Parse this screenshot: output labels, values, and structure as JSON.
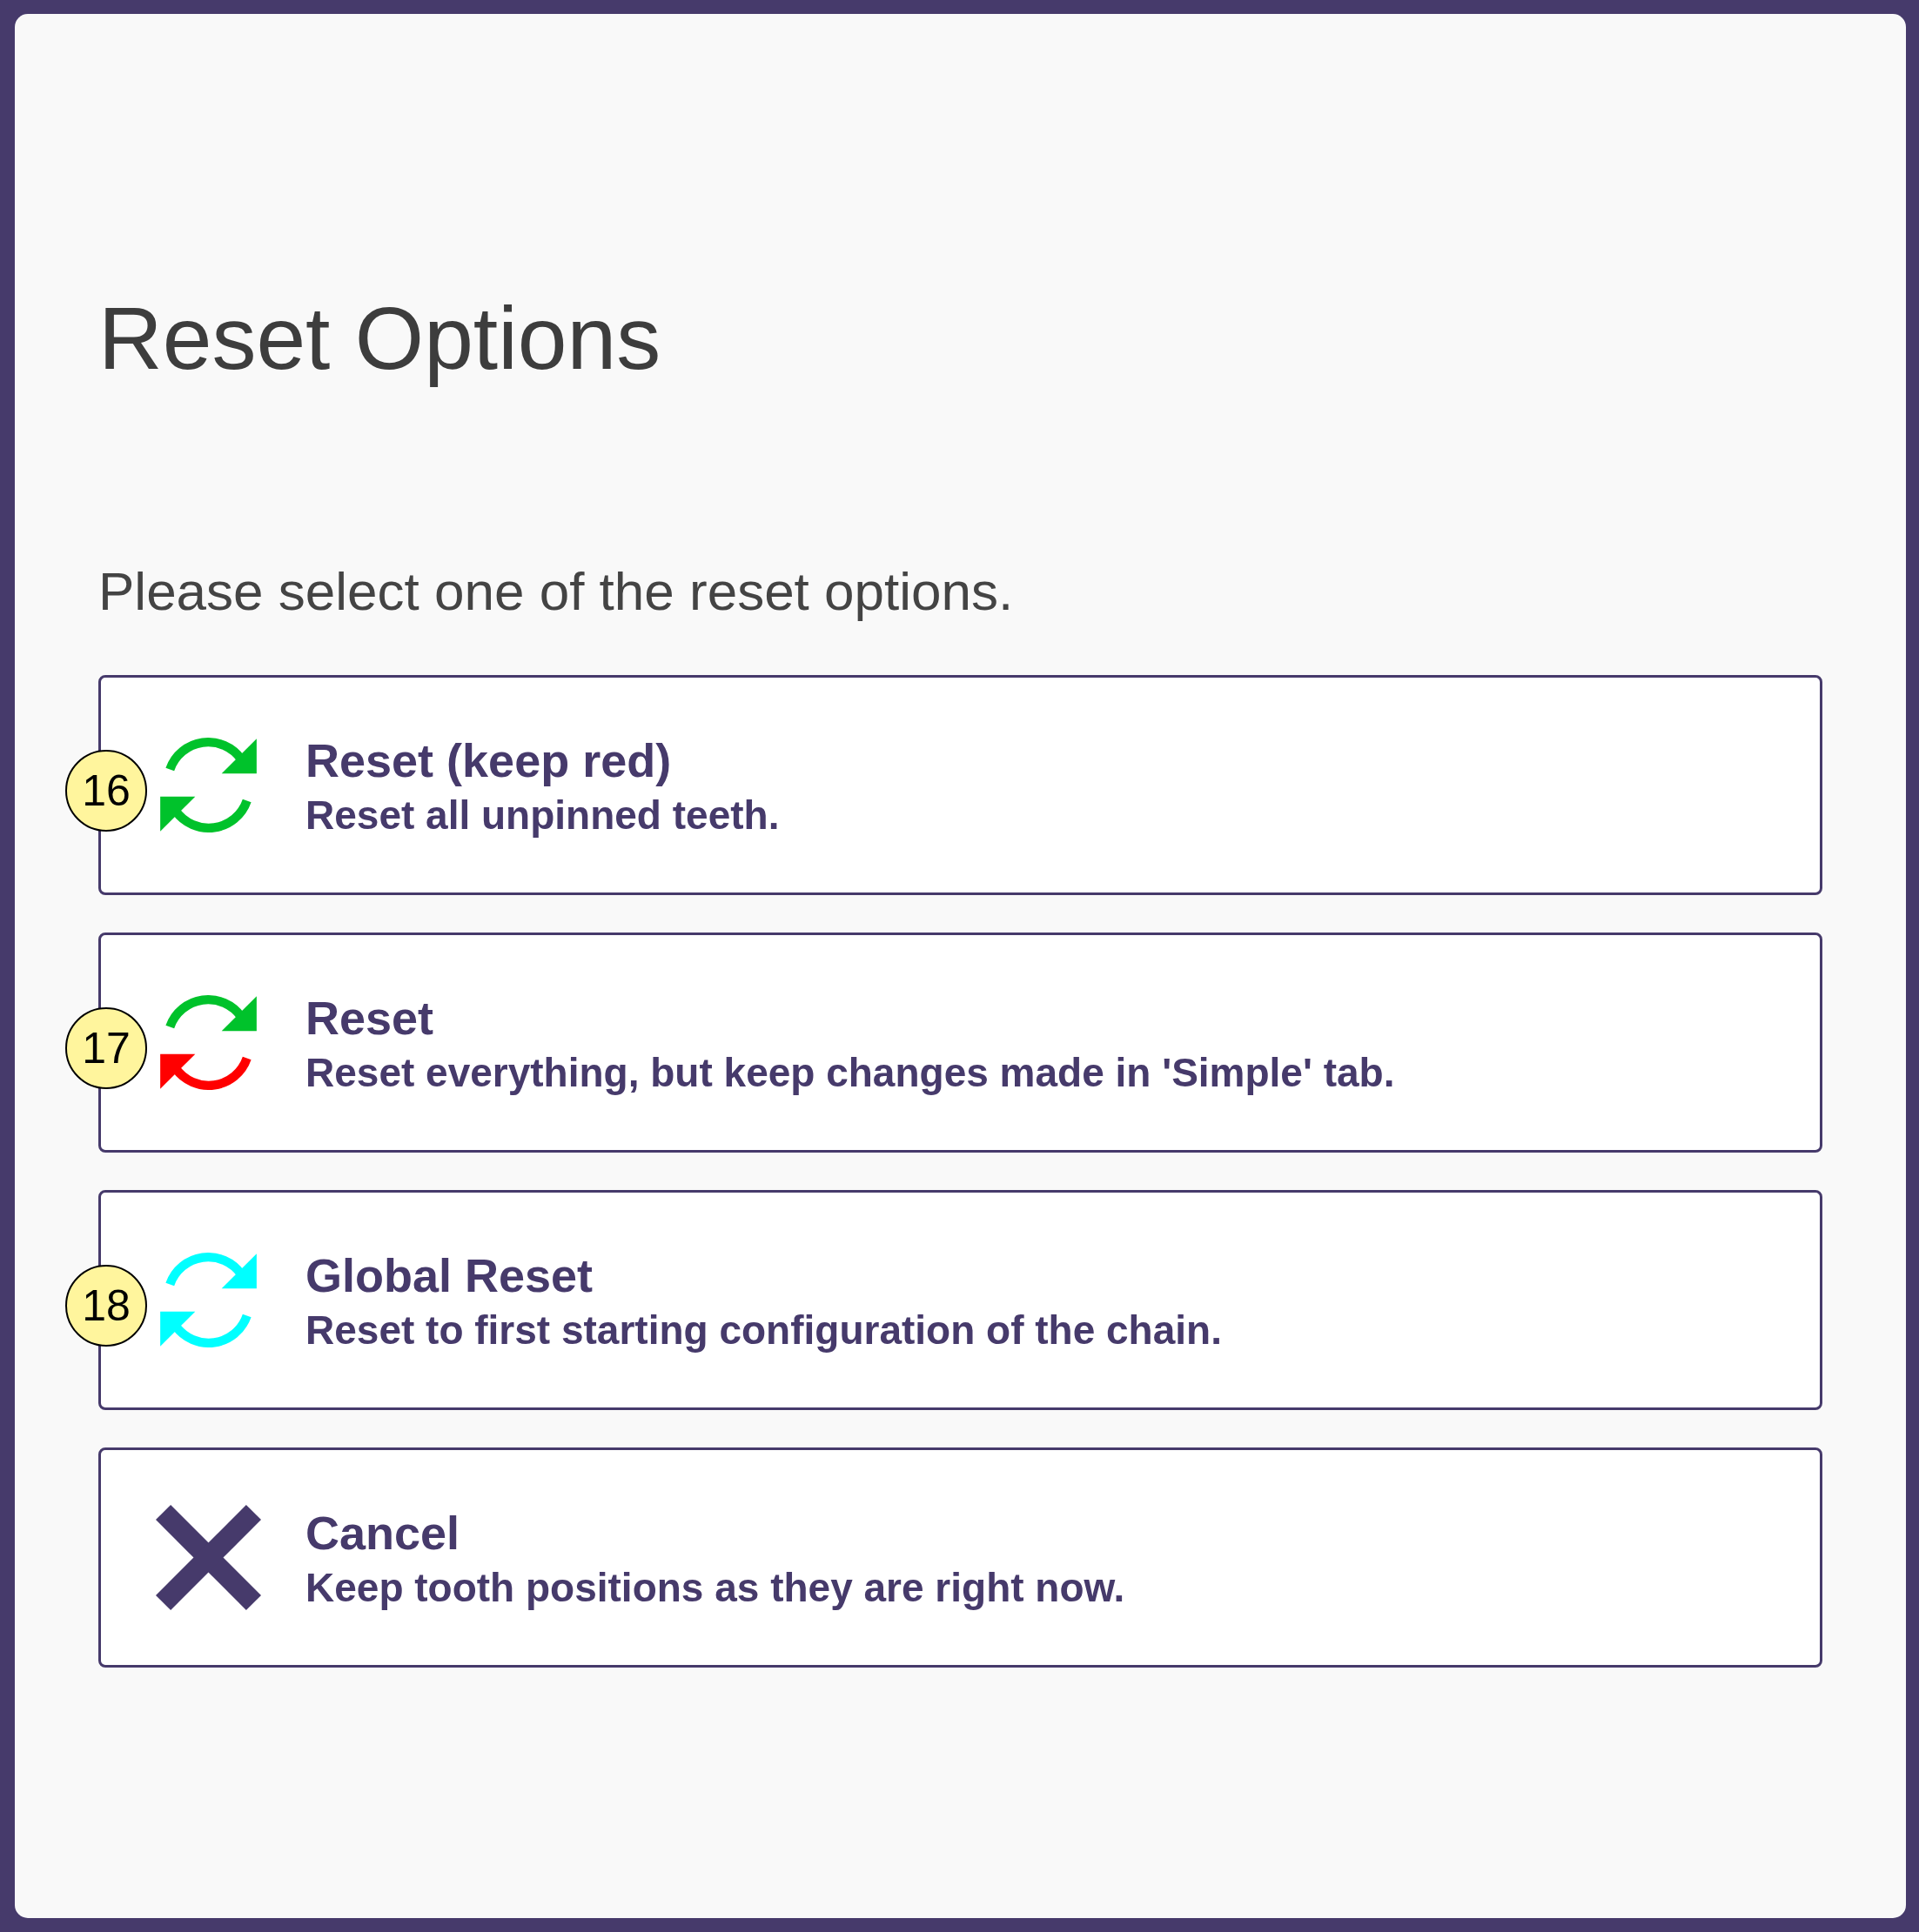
{
  "dialog": {
    "title": "Reset Options",
    "prompt": "Please select one of the reset options."
  },
  "options": [
    {
      "kind": "refresh",
      "marker": "16",
      "title": "Reset (keep red)",
      "description": "Reset all unpinned teeth.",
      "arrows": [
        {
          "color": "#00c22b"
        },
        {
          "color": "#00c22b"
        }
      ]
    },
    {
      "kind": "refresh",
      "marker": "17",
      "title": "Reset",
      "description": "Reset everything, but keep changes made in 'Simple' tab.",
      "arrows": [
        {
          "color": "#00c22b"
        },
        {
          "color": "#ff0000"
        }
      ]
    },
    {
      "kind": "refresh",
      "marker": "18",
      "title": "Global Reset",
      "description": "Reset to first starting configuration of the chain.",
      "arrows": [
        {
          "color": "#00ffff"
        },
        {
          "color": "#00ffff"
        }
      ]
    },
    {
      "kind": "cancel",
      "title": "Cancel",
      "description": "Keep tooth positions as they are right now."
    }
  ]
}
